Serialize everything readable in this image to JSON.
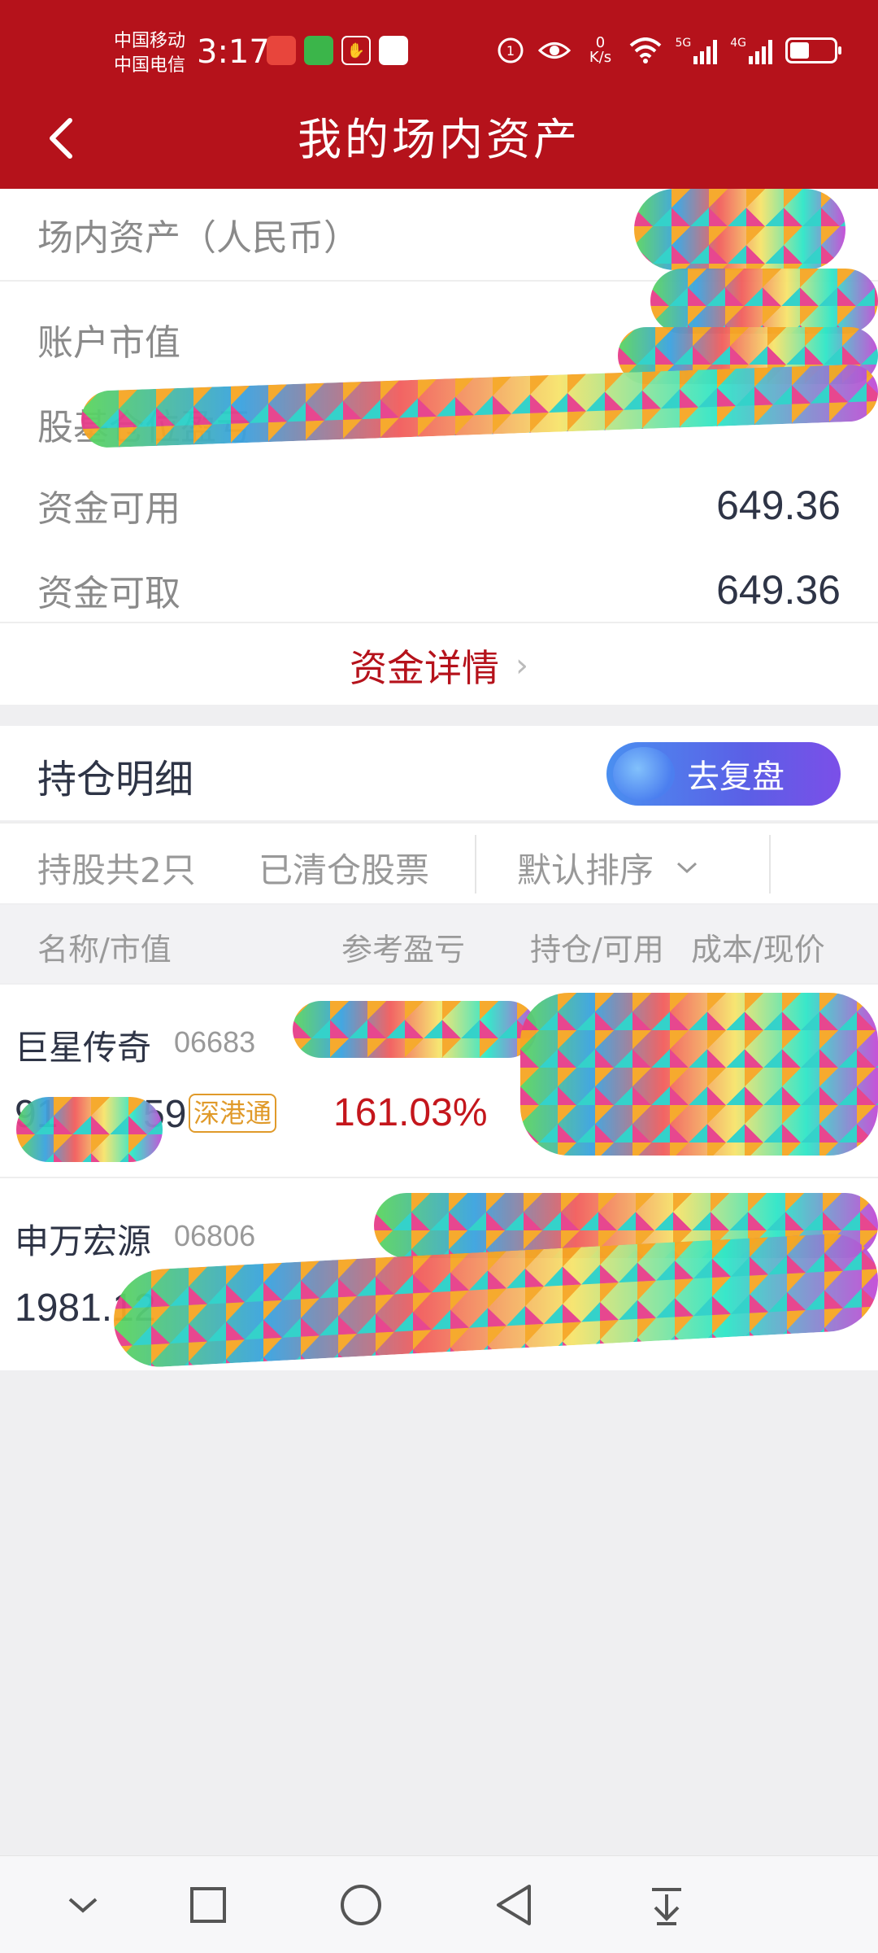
{
  "status_bar": {
    "carrier_1": "中国移动",
    "carrier_2": "中国电信",
    "time": "3:17",
    "net_speed_value": "0",
    "net_speed_unit": "K/s",
    "signal_1_label": "5G",
    "signal_2_label": "4G",
    "battery_level": 0.45
  },
  "header": {
    "title": "我的场内资产"
  },
  "assets": {
    "total_label": "场内资产（人民币）",
    "market_value_label": "账户市值",
    "profit_label": "股基仓位盈亏",
    "available_label": "资金可用",
    "available_value": "649.36",
    "withdrawable_label": "资金可取",
    "withdrawable_value": "649.36",
    "detail_link": "资金详情"
  },
  "holdings": {
    "title": "持仓明细",
    "review_button": "去复盘",
    "tabs": {
      "count": "持股共2只",
      "cleared": "已清仓股票",
      "sort": "默认排序"
    },
    "columns": {
      "name": "名称/市值",
      "pnl": "参考盈亏",
      "position": "持仓/可用",
      "cost": "成本/现价"
    },
    "stocks": [
      {
        "name": "巨星传奇",
        "code": "06683",
        "market_value": "91",
        "market_value_tail": "59",
        "badge": "深港通",
        "pnl_pct": "161.03%"
      },
      {
        "name": "申万宏源",
        "code": "06806",
        "market_value": "1981.12"
      }
    ]
  },
  "colors": {
    "brand_red": "#b5121b",
    "profit_red": "#c4161c",
    "badge_orange": "#e09a2a"
  }
}
